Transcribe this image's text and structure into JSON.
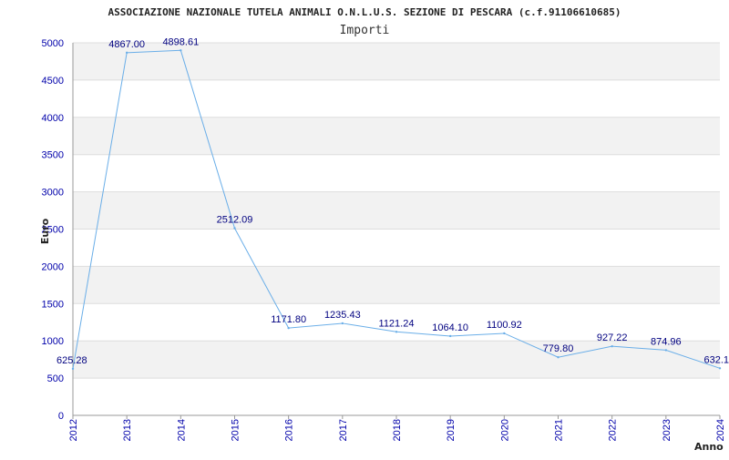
{
  "chart_data": {
    "type": "line",
    "title": "ASSOCIAZIONE NAZIONALE TUTELA ANIMALI O.N.L.U.S. SEZIONE DI PESCARA (c.f.91106610685)",
    "subtitle": "Importi",
    "xlabel": "Anno",
    "ylabel": "Euro",
    "ylim": [
      0,
      5000
    ],
    "yticks": [
      0,
      500,
      1000,
      1500,
      2000,
      2500,
      3000,
      3500,
      4000,
      4500,
      5000
    ],
    "grid": true,
    "x": [
      "2012",
      "2013",
      "2014",
      "2015",
      "2016",
      "2017",
      "2018",
      "2019",
      "2020",
      "2021",
      "2022",
      "2023",
      "2024"
    ],
    "series": [
      {
        "values": [
          625.28,
          4867.0,
          4898.61,
          2512.09,
          1171.8,
          1235.43,
          1121.24,
          1064.1,
          1100.92,
          779.8,
          927.22,
          874.96,
          632.1
        ],
        "labels": [
          "625.28",
          "4867.00",
          "4898.61",
          "2512.09",
          "1171.80",
          "1235.43",
          "1121.24",
          "1064.10",
          "1100.92",
          "779.80",
          "927.22",
          "874.96",
          "632.1"
        ],
        "color": "#6aaee8"
      }
    ]
  }
}
